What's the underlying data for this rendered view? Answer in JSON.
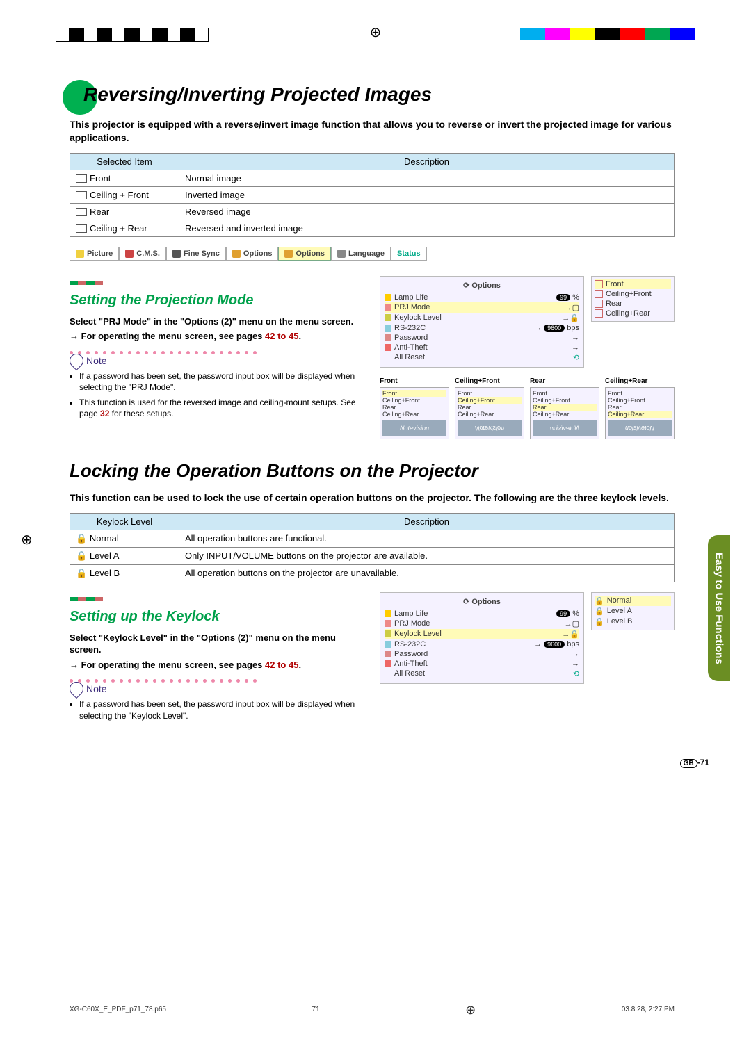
{
  "header": {
    "title": "Reversing/Inverting Projected Images",
    "intro": "This projector is equipped with a reverse/invert image function that allows you to reverse or invert the projected image for various applications."
  },
  "prj_table": {
    "col1": "Selected Item",
    "col2": "Description",
    "rows": [
      {
        "item": "Front",
        "desc": "Normal image"
      },
      {
        "item": "Ceiling + Front",
        "desc": "Inverted image"
      },
      {
        "item": "Rear",
        "desc": "Reversed image"
      },
      {
        "item": "Ceiling + Rear",
        "desc": "Reversed and inverted image"
      }
    ]
  },
  "tabs": {
    "picture": "Picture",
    "cms": "C.M.S.",
    "finesync": "Fine Sync",
    "options1": "Options",
    "options2": "Options",
    "language": "Language",
    "status": "Status"
  },
  "section_prj": {
    "heading": "Setting the Projection Mode",
    "step1": "Select \"PRJ Mode\" in the \"Options (2)\" menu on the menu screen.",
    "step2_prefix": "→ For operating the menu screen, see pages ",
    "step2_link": "42 to 45",
    "step2_suffix": ".",
    "note_label": "Note",
    "notes": [
      "If a password has been set, the password input box will be displayed when selecting the \"PRJ Mode\".",
      "This function is used for the reversed image and ceiling-mount setups. See page 32 for these setups."
    ],
    "note2_prefix": "This function is used for the reversed image and ceiling-mount setups. See page ",
    "note2_link": "32",
    "note2_suffix": " for these setups."
  },
  "osd_options": {
    "title": "Options",
    "lamp": "Lamp Life",
    "lamp_val": "99",
    "lamp_pct": "%",
    "prj": "PRJ Mode",
    "keylock": "Keylock Level",
    "rs232": "RS-232C",
    "rs232_val": "9600",
    "rs232_unit": "bps",
    "password": "Password",
    "antitheft": "Anti-Theft",
    "allreset": "All Reset",
    "side": {
      "front": "Front",
      "cfront": "Ceiling+Front",
      "rear": "Rear",
      "crear": "Ceiling+Rear"
    }
  },
  "mini_previews": {
    "labels": [
      "Front",
      "Ceiling+Front",
      "Rear",
      "Ceiling+Rear"
    ],
    "rows": [
      "Front",
      "Ceiling+Front",
      "Rear",
      "Ceiling+Rear"
    ],
    "logo": "Notevision"
  },
  "header2": {
    "title": "Locking the Operation Buttons on the Projector",
    "intro": "This function can be used to lock the use of certain operation buttons on the projector. The following are the three keylock levels."
  },
  "keylock_table": {
    "col1": "Keylock Level",
    "col2": "Description",
    "rows": [
      {
        "item": "Normal",
        "desc": "All operation buttons are functional."
      },
      {
        "item": "Level A",
        "desc": "Only INPUT/VOLUME buttons on the projector are available."
      },
      {
        "item": "Level B",
        "desc": "All operation buttons on the projector are unavailable."
      }
    ]
  },
  "section_keylock": {
    "heading": "Setting up the Keylock",
    "step1": "Select \"Keylock Level\" in the \"Options (2)\" menu on the menu screen.",
    "step2_prefix": "→ For operating the menu screen, see pages ",
    "step2_link": "42 to 45",
    "step2_suffix": ".",
    "note_label": "Note",
    "note1": "If a password has been set, the password input box will be displayed when selecting the \"Keylock Level\"."
  },
  "keylock_side": {
    "normal": "Normal",
    "a": "Level A",
    "b": "Level B"
  },
  "side_tab": "Easy to Use Functions",
  "page_num": {
    "gb": "GB",
    "num": "-71"
  },
  "footer": {
    "file": "XG-C60X_E_PDF_p71_78.p65",
    "page": "71",
    "date": "03.8.28, 2:27 PM"
  }
}
